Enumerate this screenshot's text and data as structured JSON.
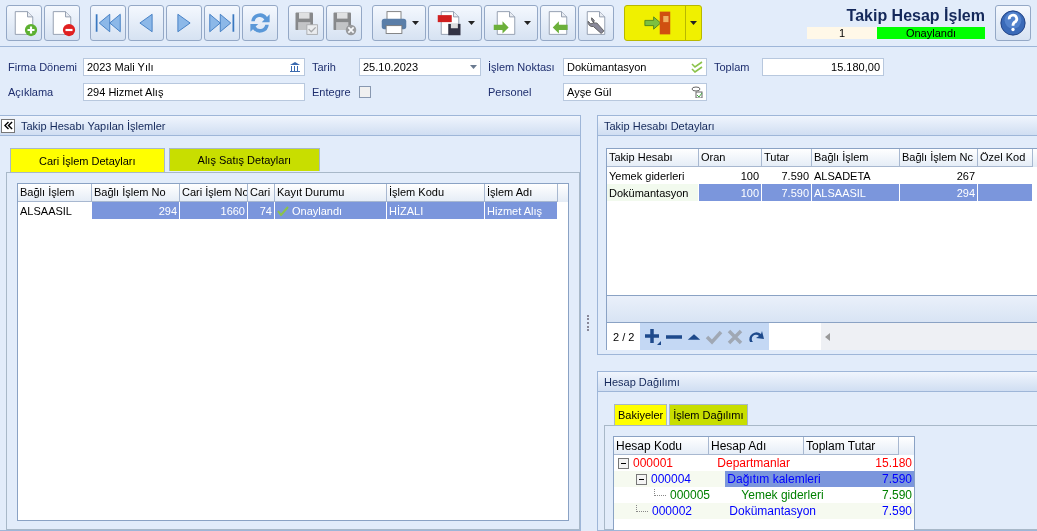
{
  "toolbar": {
    "buttons": [
      {
        "kind": "new",
        "disabled": false,
        "dropdown": false
      },
      {
        "kind": "delete",
        "disabled": false,
        "dropdown": false
      },
      {
        "kind": "first",
        "disabled": false,
        "dropdown": false
      },
      {
        "kind": "prev",
        "disabled": false,
        "dropdown": false
      },
      {
        "kind": "next",
        "disabled": false,
        "dropdown": false
      },
      {
        "kind": "last",
        "disabled": false,
        "dropdown": false
      },
      {
        "kind": "refresh",
        "disabled": false,
        "dropdown": false
      },
      {
        "kind": "save",
        "disabled": true,
        "dropdown": false
      },
      {
        "kind": "cancel",
        "disabled": true,
        "dropdown": false
      },
      {
        "kind": "print",
        "disabled": false,
        "dropdown": true
      },
      {
        "kind": "pdf",
        "disabled": false,
        "dropdown": true
      },
      {
        "kind": "export",
        "disabled": false,
        "dropdown": true
      },
      {
        "kind": "import",
        "disabled": false,
        "dropdown": false
      },
      {
        "kind": "tools",
        "disabled": false,
        "dropdown": false
      },
      {
        "kind": "exit",
        "disabled": false,
        "dropdown": true
      }
    ]
  },
  "header": {
    "title": "Takip Hesap İşlem",
    "record": "1",
    "status": {
      "text": "Onaylandı",
      "color": "#00ff00"
    }
  },
  "form": {
    "firma_donemi": {
      "label": "Firma Dönemi",
      "value": "2023 Mali Yılı"
    },
    "tarih": {
      "label": "Tarih",
      "value": "25.10.2023"
    },
    "islem_noktasi": {
      "label": "İşlem Noktası",
      "value": "Dokümantasyon"
    },
    "toplam": {
      "label": "Toplam",
      "value": "15.180,00"
    },
    "aciklama": {
      "label": "Açıklama",
      "value": "294 Hizmet Alış"
    },
    "entegre": {
      "label": "Entegre",
      "checked": false
    },
    "personel": {
      "label": "Personel",
      "value": "Ayşe Gül"
    }
  },
  "left_panel": {
    "title": "Takip Hesabı Yapılan İşlemler",
    "tabs": [
      {
        "label": "Cari İşlem Detayları",
        "selected": true
      },
      {
        "label": "Alış Satış Detayları",
        "selected": false
      }
    ],
    "table": {
      "columns": [
        "Bağlı İşlem",
        "Bağlı İşlem No",
        "Cari İşlem No",
        "Cari",
        "Kayıt Durumu",
        "İşlem Kodu",
        "İşlem Adı"
      ],
      "rows": [
        {
          "cells": [
            "ALSAASIL",
            "294",
            "1660",
            "74",
            "Onaylandı",
            "HİZALI",
            "Hizmet Alış"
          ],
          "approved": true,
          "selected": true
        }
      ]
    }
  },
  "details_panel": {
    "title": "Takip Hesabı Detayları",
    "table": {
      "columns": [
        "Takip Hesabı",
        "Oran",
        "Tutar",
        "Bağlı İşlem",
        "Bağlı İşlem Nc",
        "Özel Kod"
      ],
      "rows": [
        {
          "cells": [
            "Yemek giderleri",
            "100",
            "7.590",
            "ALSADETA",
            "267",
            ""
          ],
          "selected": false
        },
        {
          "cells": [
            "Dokümantasyon",
            "100",
            "7.590",
            "ALSAASIL",
            "294",
            ""
          ],
          "selected": true
        }
      ]
    },
    "navigator": {
      "position": "2 / 2"
    }
  },
  "distribution_panel": {
    "title": "Hesap Dağılımı",
    "tabs": [
      {
        "label": "Bakiyeler",
        "selected": true
      },
      {
        "label": "İşlem Dağılımı",
        "selected": false
      }
    ],
    "tree": {
      "columns": [
        "Hesap Kodu",
        "Hesap Adı",
        "Toplam Tutar"
      ],
      "nodes": [
        {
          "code": "000001",
          "name": "Departmanlar",
          "amount": "15.180",
          "color": "#ff0000",
          "selected": false,
          "expanded": true,
          "children": [
            {
              "code": "000004",
              "name": "Dağıtım kalemleri",
              "amount": "7.590",
              "color": "#0000ff",
              "selected": true,
              "expanded": true,
              "children": [
                {
                  "code": "000005",
                  "name": "Yemek giderleri",
                  "amount": "7.590",
                  "color": "#008000",
                  "selected": false
                }
              ]
            },
            {
              "code": "000002",
              "name": "Dokümantasyon",
              "amount": "7.590",
              "color": "#0000ff",
              "selected": false
            }
          ]
        }
      ]
    }
  }
}
